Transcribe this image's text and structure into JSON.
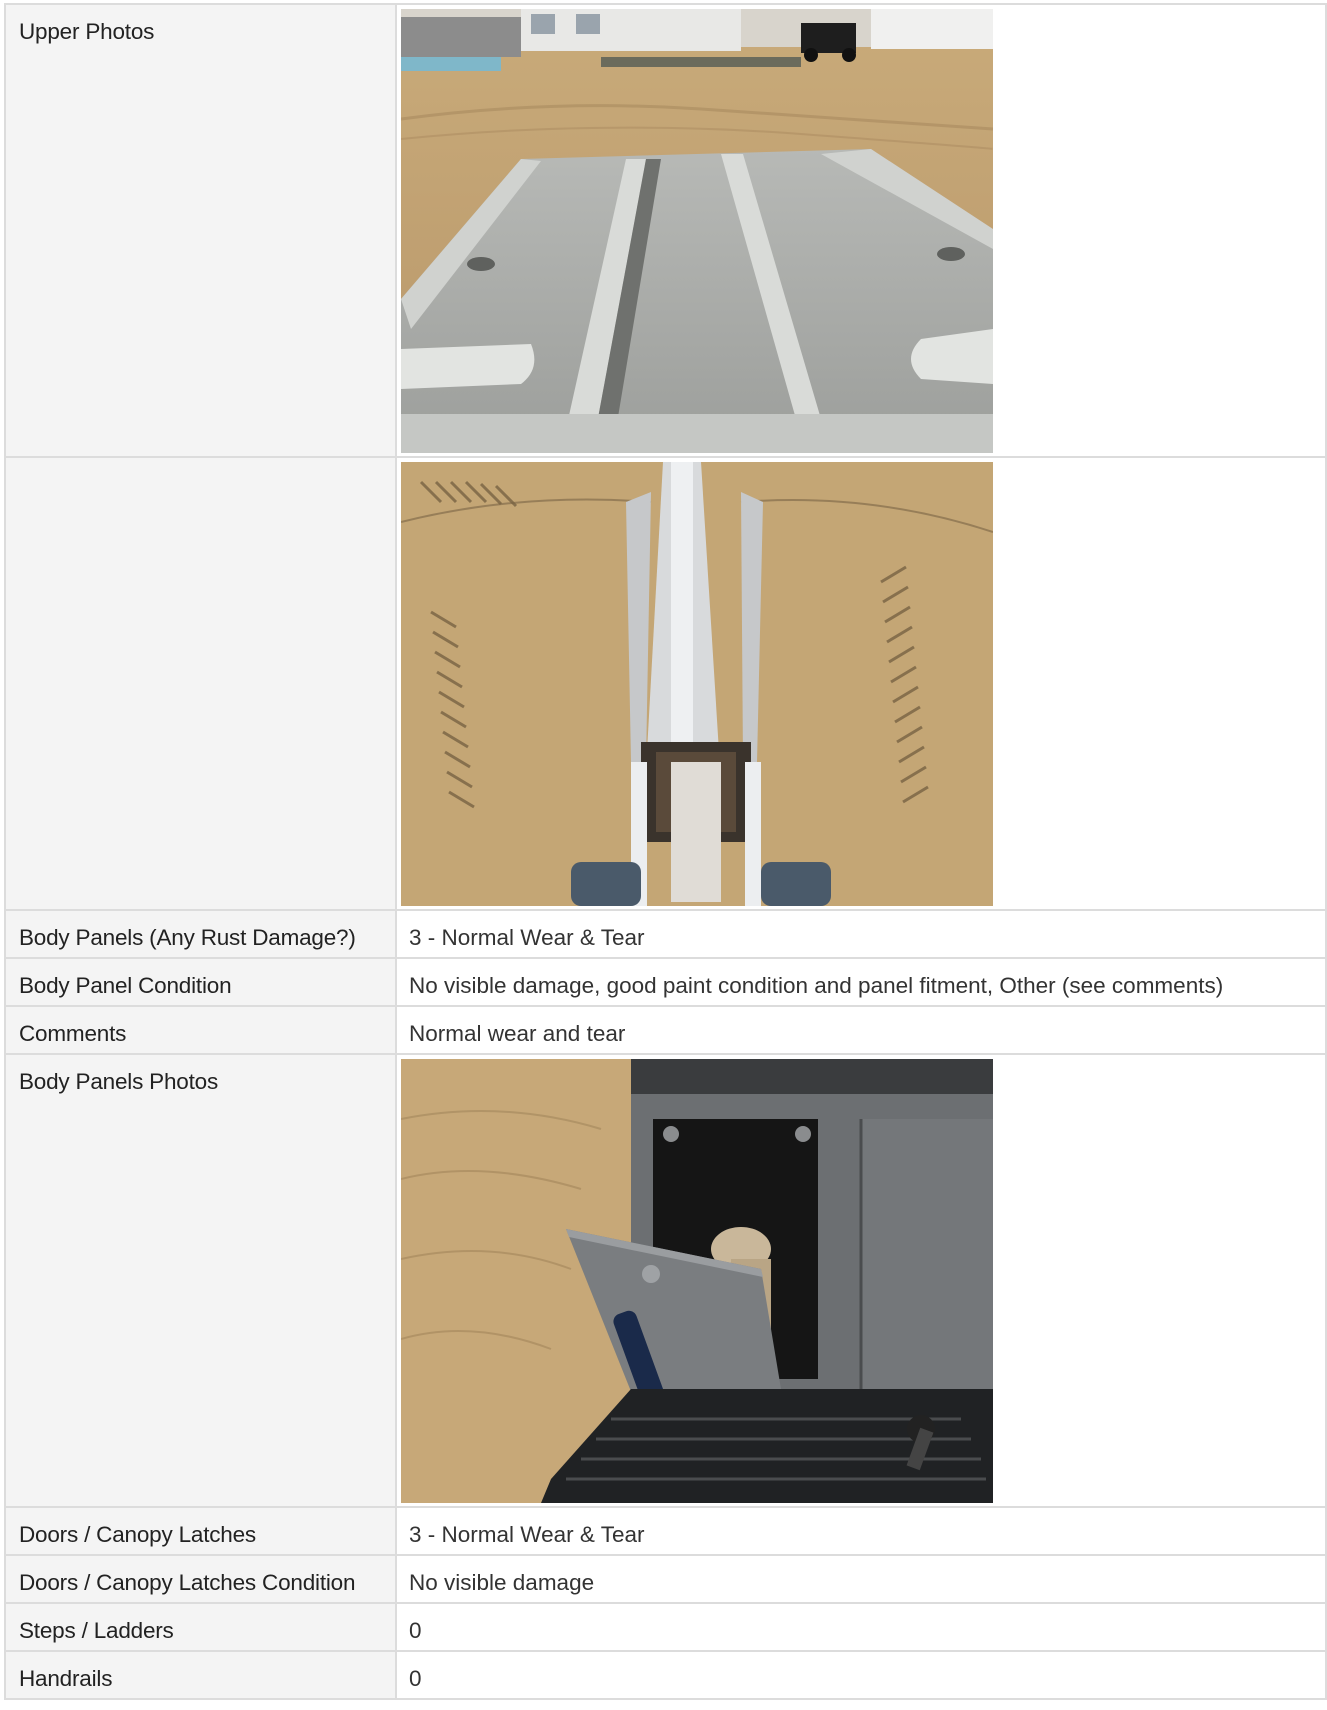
{
  "rows": [
    {
      "label": "Upper Photos",
      "photo": "excavator-canopy-roof-photo"
    },
    {
      "label": "",
      "photo": "excavator-boom-arm-photo"
    },
    {
      "label": "Body Panels (Any Rust Damage?)",
      "value": "3 - Normal Wear & Tear"
    },
    {
      "label": "Body Panel Condition",
      "value": "No visible damage, good paint condition and panel fitment, Other (see comments)"
    },
    {
      "label": "Comments",
      "value": "Normal wear and tear"
    },
    {
      "label": "Body Panels Photos",
      "photo": "excavator-body-panel-access-door-photo"
    },
    {
      "label": "Doors / Canopy Latches",
      "value": "3 - Normal Wear & Tear"
    },
    {
      "label": "Doors / Canopy Latches Condition",
      "value": "No visible damage"
    },
    {
      "label": "Steps / Ladders",
      "value": "0"
    },
    {
      "label": "Handrails",
      "value": "0"
    }
  ],
  "colors": {
    "label_bg": "#f4f4f4",
    "border": "#dcdcdc",
    "sand": "#c8a877"
  }
}
